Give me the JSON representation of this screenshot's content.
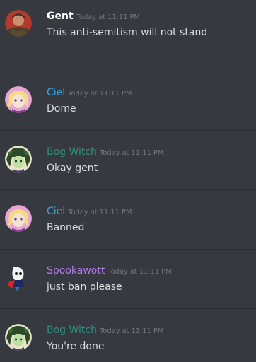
{
  "messages": [
    {
      "author": "Gent",
      "time": "Today at 11:11 PM",
      "text": "This anti-semitism will not stand",
      "color": "#ffffff",
      "avatar": "gent-avatar"
    },
    {
      "author": "Ciel",
      "time": "Today at 11:11 PM",
      "text": "Dome",
      "color": "#3ea2db",
      "avatar": "ciel-avatar"
    },
    {
      "author": "Bog Witch",
      "time": "Today at 11:11 PM",
      "text": "Okay gent",
      "color": "#2f8f7b",
      "avatar": "bog-witch-avatar"
    },
    {
      "author": "Ciel",
      "time": "Today at 11:11 PM",
      "text": "Banned",
      "color": "#3ea2db",
      "avatar": "ciel-avatar"
    },
    {
      "author": "Spookawott",
      "time": "Today at 11:11 PM",
      "text": "just ban please",
      "color": "#b57bf0",
      "avatar": "spookawott-avatar"
    },
    {
      "author": "Bog Witch",
      "time": "Today at 11:11 PM",
      "text": "You're done",
      "color": "#2f8f7b",
      "avatar": "bog-witch-avatar"
    }
  ],
  "colors": {
    "background": "#36393f",
    "divider": "#2b2e33",
    "new_messages_line": "#f04747",
    "message_text": "#dcddde",
    "timestamp": "#72767d"
  }
}
